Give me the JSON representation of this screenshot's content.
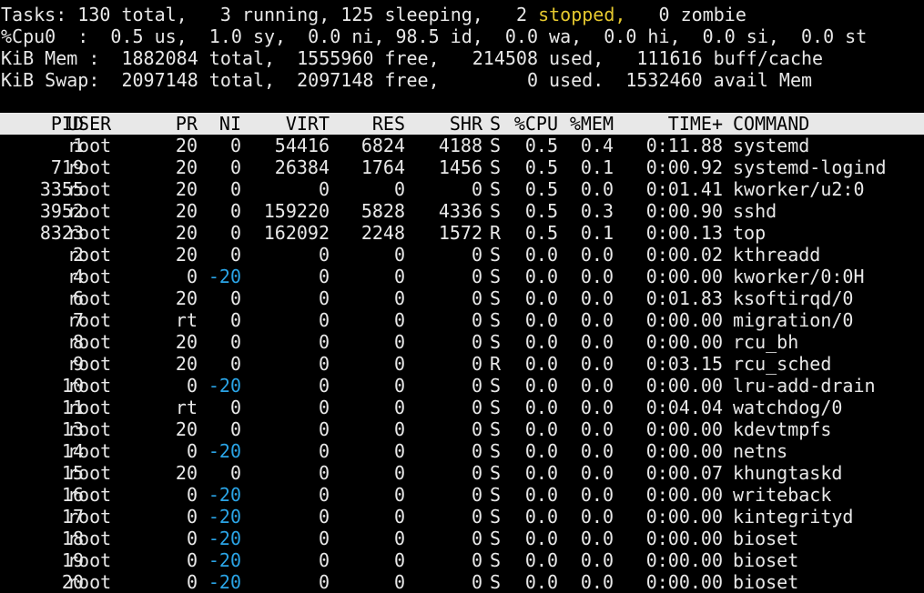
{
  "summary": {
    "tasks": {
      "label": "Tasks:",
      "total": "130 total,",
      "running": "3 running,",
      "sleeping": "125 sleeping,",
      "stopped_count": "2",
      "stopped_label": "stopped,",
      "zombie": "0 zombie"
    },
    "cpu": "%Cpu0  :  0.5 us,  1.0 sy,  0.0 ni, 98.5 id,  0.0 wa,  0.0 hi,  0.0 si,  0.0 st",
    "mem": "KiB Mem :  1882084 total,  1555960 free,   214508 used,   111616 buff/cache",
    "swap": "KiB Swap:  2097148 total,  2097148 free,        0 used.  1532460 avail Mem"
  },
  "table": {
    "headers": {
      "pid": "PID",
      "user": "USER",
      "pr": "PR",
      "ni": "NI",
      "virt": "VIRT",
      "res": "RES",
      "shr": "SHR",
      "s": "S",
      "cpu": "%CPU",
      "mem": "%MEM",
      "time": "TIME+",
      "command": "COMMAND"
    },
    "rows": [
      {
        "pid": "1",
        "user": "root",
        "pr": "20",
        "ni": "0",
        "virt": "54416",
        "res": "6824",
        "shr": "4188",
        "s": "S",
        "cpu": "0.5",
        "mem": "0.4",
        "time": "0:11.88",
        "command": "systemd"
      },
      {
        "pid": "719",
        "user": "root",
        "pr": "20",
        "ni": "0",
        "virt": "26384",
        "res": "1764",
        "shr": "1456",
        "s": "S",
        "cpu": "0.5",
        "mem": "0.1",
        "time": "0:00.92",
        "command": "systemd-logind"
      },
      {
        "pid": "3355",
        "user": "root",
        "pr": "20",
        "ni": "0",
        "virt": "0",
        "res": "0",
        "shr": "0",
        "s": "S",
        "cpu": "0.5",
        "mem": "0.0",
        "time": "0:01.41",
        "command": "kworker/u2:0"
      },
      {
        "pid": "3952",
        "user": "root",
        "pr": "20",
        "ni": "0",
        "virt": "159220",
        "res": "5828",
        "shr": "4336",
        "s": "S",
        "cpu": "0.5",
        "mem": "0.3",
        "time": "0:00.90",
        "command": "sshd"
      },
      {
        "pid": "8323",
        "user": "root",
        "pr": "20",
        "ni": "0",
        "virt": "162092",
        "res": "2248",
        "shr": "1572",
        "s": "R",
        "cpu": "0.5",
        "mem": "0.1",
        "time": "0:00.13",
        "command": "top"
      },
      {
        "pid": "2",
        "user": "root",
        "pr": "20",
        "ni": "0",
        "virt": "0",
        "res": "0",
        "shr": "0",
        "s": "S",
        "cpu": "0.0",
        "mem": "0.0",
        "time": "0:00.02",
        "command": "kthreadd"
      },
      {
        "pid": "4",
        "user": "root",
        "pr": "0",
        "ni": "-20",
        "virt": "0",
        "res": "0",
        "shr": "0",
        "s": "S",
        "cpu": "0.0",
        "mem": "0.0",
        "time": "0:00.00",
        "command": "kworker/0:0H"
      },
      {
        "pid": "6",
        "user": "root",
        "pr": "20",
        "ni": "0",
        "virt": "0",
        "res": "0",
        "shr": "0",
        "s": "S",
        "cpu": "0.0",
        "mem": "0.0",
        "time": "0:01.83",
        "command": "ksoftirqd/0"
      },
      {
        "pid": "7",
        "user": "root",
        "pr": "rt",
        "ni": "0",
        "virt": "0",
        "res": "0",
        "shr": "0",
        "s": "S",
        "cpu": "0.0",
        "mem": "0.0",
        "time": "0:00.00",
        "command": "migration/0"
      },
      {
        "pid": "8",
        "user": "root",
        "pr": "20",
        "ni": "0",
        "virt": "0",
        "res": "0",
        "shr": "0",
        "s": "S",
        "cpu": "0.0",
        "mem": "0.0",
        "time": "0:00.00",
        "command": "rcu_bh"
      },
      {
        "pid": "9",
        "user": "root",
        "pr": "20",
        "ni": "0",
        "virt": "0",
        "res": "0",
        "shr": "0",
        "s": "R",
        "cpu": "0.0",
        "mem": "0.0",
        "time": "0:03.15",
        "command": "rcu_sched"
      },
      {
        "pid": "10",
        "user": "root",
        "pr": "0",
        "ni": "-20",
        "virt": "0",
        "res": "0",
        "shr": "0",
        "s": "S",
        "cpu": "0.0",
        "mem": "0.0",
        "time": "0:00.00",
        "command": "lru-add-drain"
      },
      {
        "pid": "11",
        "user": "root",
        "pr": "rt",
        "ni": "0",
        "virt": "0",
        "res": "0",
        "shr": "0",
        "s": "S",
        "cpu": "0.0",
        "mem": "0.0",
        "time": "0:04.04",
        "command": "watchdog/0"
      },
      {
        "pid": "13",
        "user": "root",
        "pr": "20",
        "ni": "0",
        "virt": "0",
        "res": "0",
        "shr": "0",
        "s": "S",
        "cpu": "0.0",
        "mem": "0.0",
        "time": "0:00.00",
        "command": "kdevtmpfs"
      },
      {
        "pid": "14",
        "user": "root",
        "pr": "0",
        "ni": "-20",
        "virt": "0",
        "res": "0",
        "shr": "0",
        "s": "S",
        "cpu": "0.0",
        "mem": "0.0",
        "time": "0:00.00",
        "command": "netns"
      },
      {
        "pid": "15",
        "user": "root",
        "pr": "20",
        "ni": "0",
        "virt": "0",
        "res": "0",
        "shr": "0",
        "s": "S",
        "cpu": "0.0",
        "mem": "0.0",
        "time": "0:00.07",
        "command": "khungtaskd"
      },
      {
        "pid": "16",
        "user": "root",
        "pr": "0",
        "ni": "-20",
        "virt": "0",
        "res": "0",
        "shr": "0",
        "s": "S",
        "cpu": "0.0",
        "mem": "0.0",
        "time": "0:00.00",
        "command": "writeback"
      },
      {
        "pid": "17",
        "user": "root",
        "pr": "0",
        "ni": "-20",
        "virt": "0",
        "res": "0",
        "shr": "0",
        "s": "S",
        "cpu": "0.0",
        "mem": "0.0",
        "time": "0:00.00",
        "command": "kintegrityd"
      },
      {
        "pid": "18",
        "user": "root",
        "pr": "0",
        "ni": "-20",
        "virt": "0",
        "res": "0",
        "shr": "0",
        "s": "S",
        "cpu": "0.0",
        "mem": "0.0",
        "time": "0:00.00",
        "command": "bioset"
      },
      {
        "pid": "19",
        "user": "root",
        "pr": "0",
        "ni": "-20",
        "virt": "0",
        "res": "0",
        "shr": "0",
        "s": "S",
        "cpu": "0.0",
        "mem": "0.0",
        "time": "0:00.00",
        "command": "bioset"
      },
      {
        "pid": "20",
        "user": "root",
        "pr": "0",
        "ni": "-20",
        "virt": "0",
        "res": "0",
        "shr": "0",
        "s": "S",
        "cpu": "0.0",
        "mem": "0.0",
        "time": "0:00.00",
        "command": "bioset"
      }
    ]
  },
  "colors": {
    "background": "#000000",
    "foreground": "#e8e8e8",
    "header_bg": "#e8e8e8",
    "header_fg": "#000000",
    "stopped": "#e5c82f",
    "negative_nice": "#2aa4e6"
  }
}
